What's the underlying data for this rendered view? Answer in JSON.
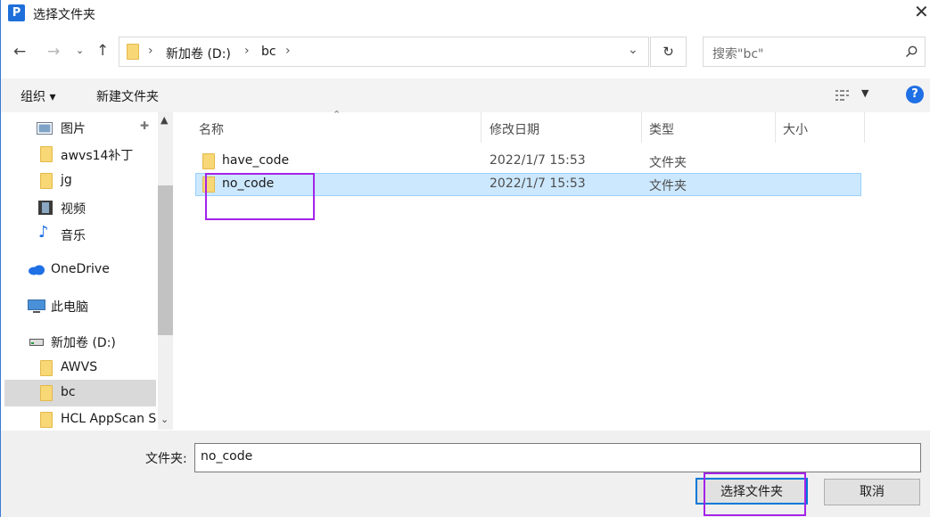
{
  "window": {
    "title": "选择文件夹",
    "app_icon_letter": "P"
  },
  "address": {
    "segments": [
      "新加卷 (D:)",
      "bc"
    ]
  },
  "search": {
    "placeholder": "搜索\"bc\""
  },
  "toolbar": {
    "organize": "组织 ▾",
    "new_folder": "新建文件夹",
    "help": "?"
  },
  "nav": {
    "items": [
      {
        "label": "图片"
      },
      {
        "label": "awvs14补丁"
      },
      {
        "label": "jg"
      },
      {
        "label": "视频"
      },
      {
        "label": "音乐"
      },
      {
        "label": "OneDrive"
      },
      {
        "label": "此电脑"
      },
      {
        "label": "新加卷 (D:)"
      },
      {
        "label": "AWVS"
      },
      {
        "label": "bc",
        "selected": true
      },
      {
        "label": "HCL AppScan S"
      }
    ]
  },
  "columns": {
    "name": "名称",
    "modified": "修改日期",
    "type": "类型",
    "size": "大小"
  },
  "files": [
    {
      "name": "have_code",
      "modified": "2022/1/7 15:53",
      "type": "文件夹",
      "selected": false
    },
    {
      "name": "no_code",
      "modified": "2022/1/7 15:53",
      "type": "文件夹",
      "selected": true
    }
  ],
  "footer": {
    "folder_label": "文件夹:",
    "folder_value": "no_code",
    "select_btn": "选择文件夹",
    "cancel_btn": "取消"
  },
  "colors": {
    "accent": "#0078d7",
    "selection": "#cce8ff",
    "annotation": "#a323e8"
  }
}
